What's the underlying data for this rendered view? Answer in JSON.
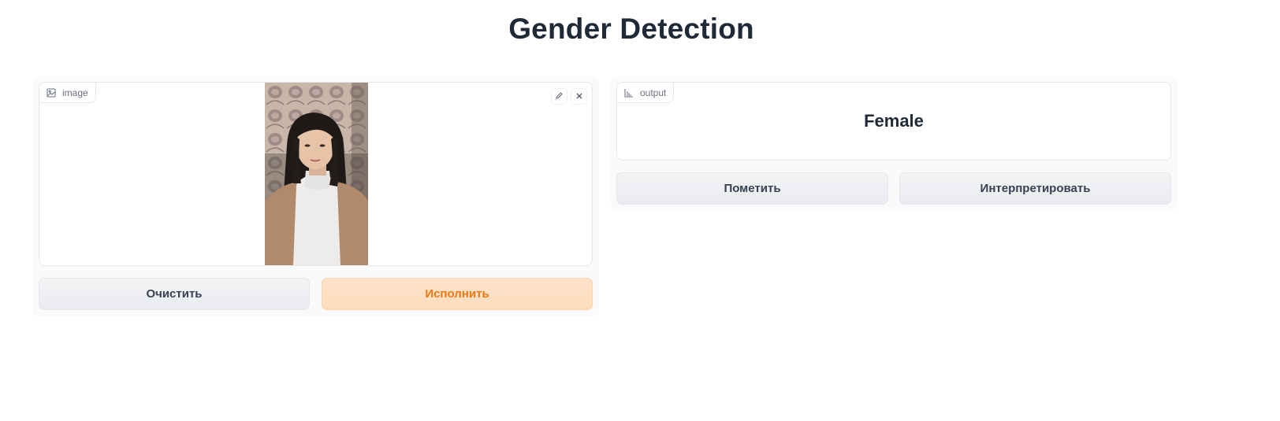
{
  "page": {
    "title": "Gender Detection"
  },
  "input": {
    "label": "image",
    "icon": "image-icon",
    "edit_icon": "pencil-icon",
    "clear_icon": "close-icon"
  },
  "output": {
    "label": "output",
    "icon": "bar-chart-icon",
    "value": "Female"
  },
  "buttons": {
    "clear": "Очистить",
    "submit": "Исполнить",
    "flag": "Пометить",
    "interpret": "Интерпретировать"
  },
  "colors": {
    "primary_text": "#ea7a16",
    "primary_bg": "#fddcbd"
  }
}
